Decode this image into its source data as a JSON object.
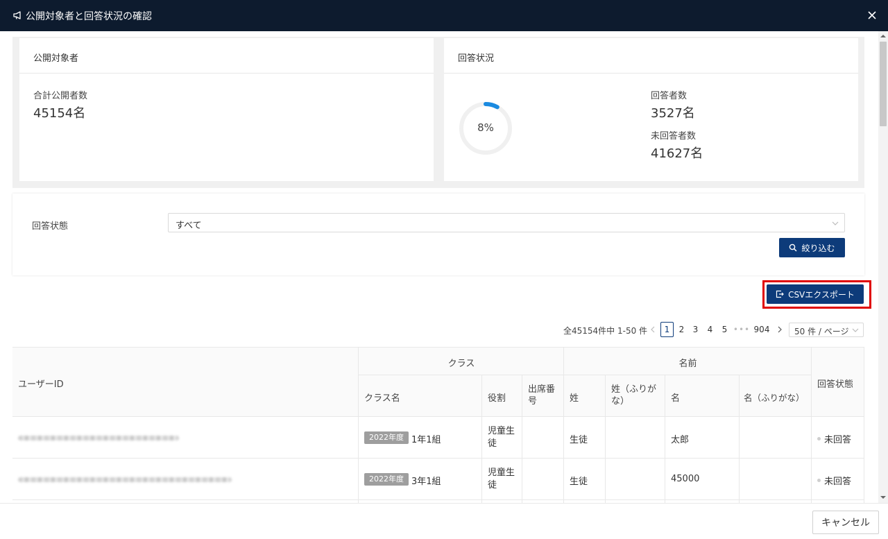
{
  "dialog": {
    "title": "公開対象者と回答状況の確認",
    "icons": {
      "title": "megaphone-icon",
      "close": "close-icon"
    }
  },
  "summary": {
    "target": {
      "title": "公開対象者",
      "total_label": "合計公開者数",
      "total_value": "45154名"
    },
    "status": {
      "title": "回答状況",
      "progress_percent": 8,
      "progress_text": "8%",
      "answered_label": "回答者数",
      "answered_value": "3527名",
      "unanswered_label": "未回答者数",
      "unanswered_value": "41627名",
      "ring_color": "#1a8ae0"
    }
  },
  "filter": {
    "label": "回答状態",
    "selected": "すべて",
    "button_label": "絞り込む",
    "button_icon": "search-icon"
  },
  "export": {
    "button_label": "CSVエクスポート",
    "button_icon": "export-icon",
    "highlight_color": "#e00000"
  },
  "pagination": {
    "summary": "全45154件中 1-50 件",
    "pages": [
      "1",
      "2",
      "3",
      "4",
      "5"
    ],
    "ellipsis": "•••",
    "last_page": "904",
    "current": "1",
    "page_size": "50 件 / ページ"
  },
  "table": {
    "headers": {
      "user_id": "ユーザーID",
      "class_group": "クラス",
      "class_name": "クラス名",
      "role": "役割",
      "seat_number": "出席番号",
      "name_group": "名前",
      "last_name": "姓",
      "last_name_kana": "姓（ふりがな）",
      "first_name": "名",
      "first_name_kana": "名（ふりがな）",
      "status": "回答状態"
    },
    "rows": [
      {
        "year_badge": "2022年度",
        "class_name": "1年1組",
        "role": "児童生徒",
        "seat_number": "",
        "last_name": "生徒",
        "last_name_kana": "",
        "first_name": "太郎",
        "first_name_kana": "",
        "status": "未回答"
      },
      {
        "year_badge": "2022年度",
        "class_name": "3年1組",
        "role": "児童生徒",
        "seat_number": "",
        "last_name": "生徒",
        "last_name_kana": "",
        "first_name": "45000",
        "first_name_kana": "",
        "status": "未回答"
      }
    ]
  },
  "footer": {
    "cancel_label": "キャンセル"
  },
  "colors": {
    "header_bg": "#0d1b2e",
    "primary": "#0d3b7a"
  }
}
